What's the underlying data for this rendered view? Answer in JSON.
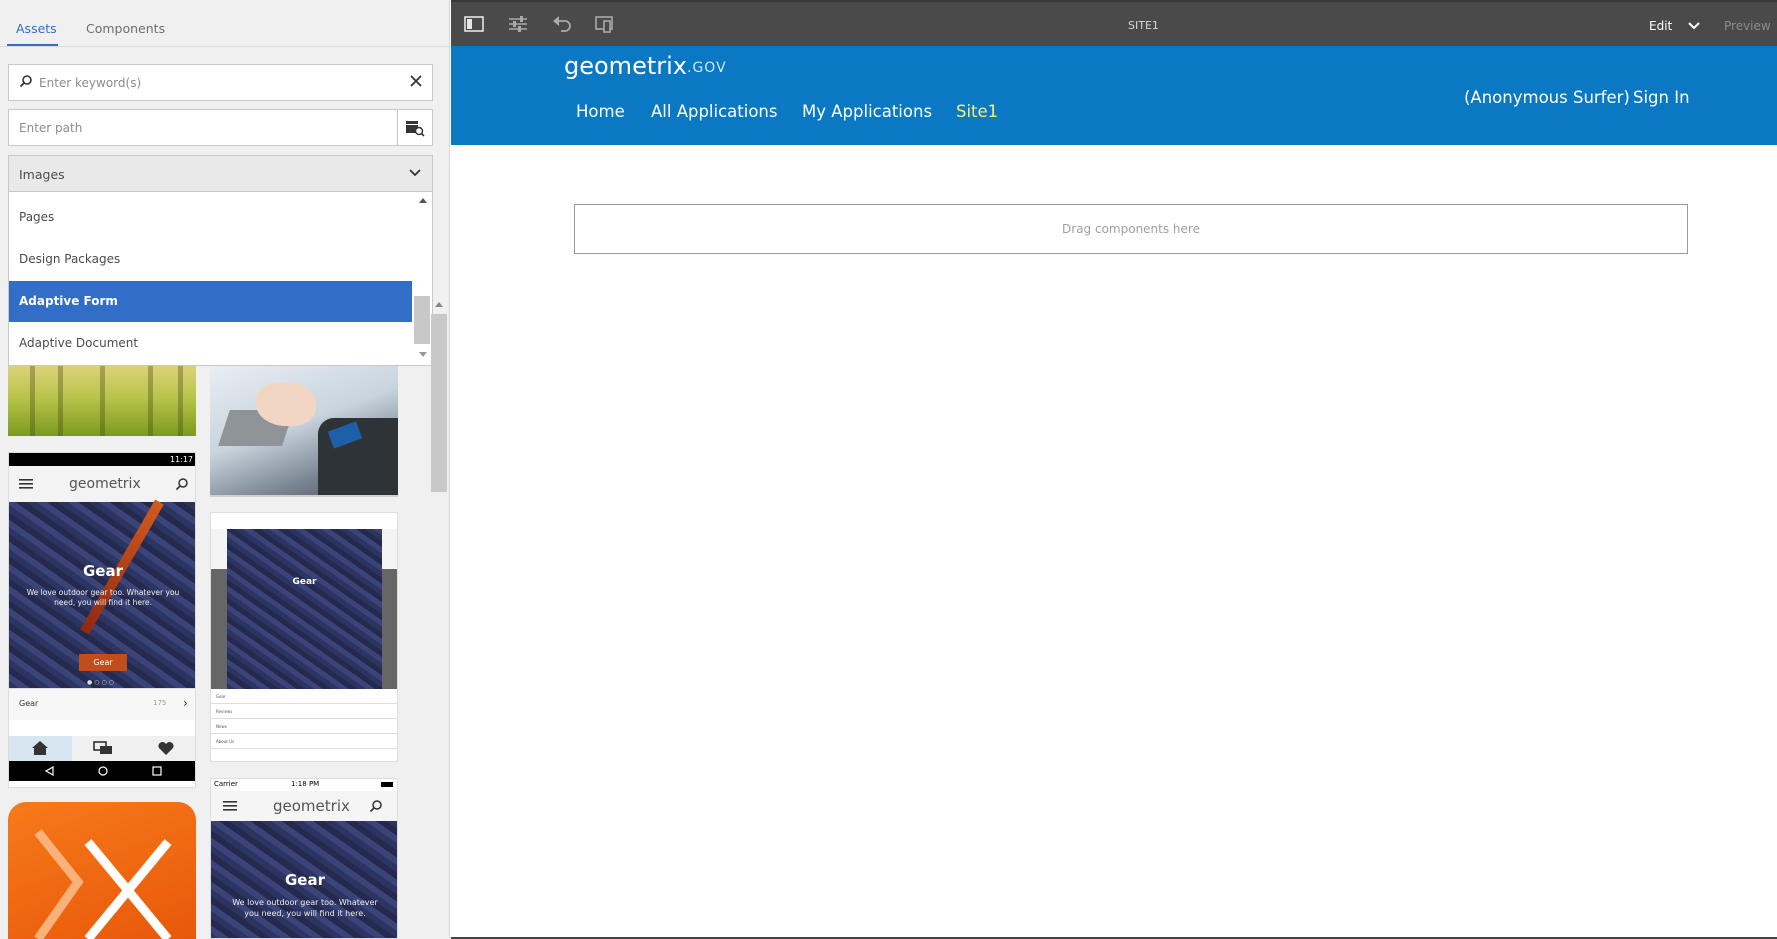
{
  "left_panel": {
    "tabs": [
      {
        "label": "Assets",
        "active": true
      },
      {
        "label": "Components",
        "active": false
      }
    ],
    "search": {
      "placeholder": "Enter keyword(s)"
    },
    "path": {
      "placeholder": "Enter path"
    },
    "asset_type": {
      "selected": "Images",
      "options": [
        "Pages",
        "Design Packages",
        "Adaptive Form",
        "Adaptive Document"
      ],
      "highlighted": "Adaptive Form"
    },
    "thumbnails": {
      "phone1": {
        "time": "11:17",
        "logo": "geometrix",
        "hero_title": "Gear",
        "hero_text": "We love outdoor gear too. Whatever you need, you will find it here.",
        "hero_button": "Gear",
        "row_label": "Gear",
        "row_count": "175"
      },
      "phone2": {
        "list": [
          "Gear",
          "Reviews",
          "News",
          "About Us"
        ]
      },
      "phone3": {
        "carrier": "Carrier",
        "time": "1:18 PM",
        "logo": "geometrix",
        "hero_title": "Gear",
        "hero_text": "We love outdoor gear too. Whatever you need, you will find it here."
      }
    }
  },
  "toolbar": {
    "title": "SITE1",
    "mode": "Edit",
    "preview": "Preview"
  },
  "site_header": {
    "brand": "geometrix",
    "brand_suffix": ".GOV",
    "nav": [
      "Home",
      "All Applications",
      "My Applications",
      "Site1"
    ],
    "current_nav": "Site1",
    "user": "(Anonymous Surfer)",
    "sign_in": "Sign In"
  },
  "canvas": {
    "drop_zone": "Drag components here"
  },
  "colors": {
    "accent": "#326ec8",
    "header_blue": "#0a78c2",
    "toolbar": "#4a4a4a",
    "current_nav": "#f6f07a"
  }
}
